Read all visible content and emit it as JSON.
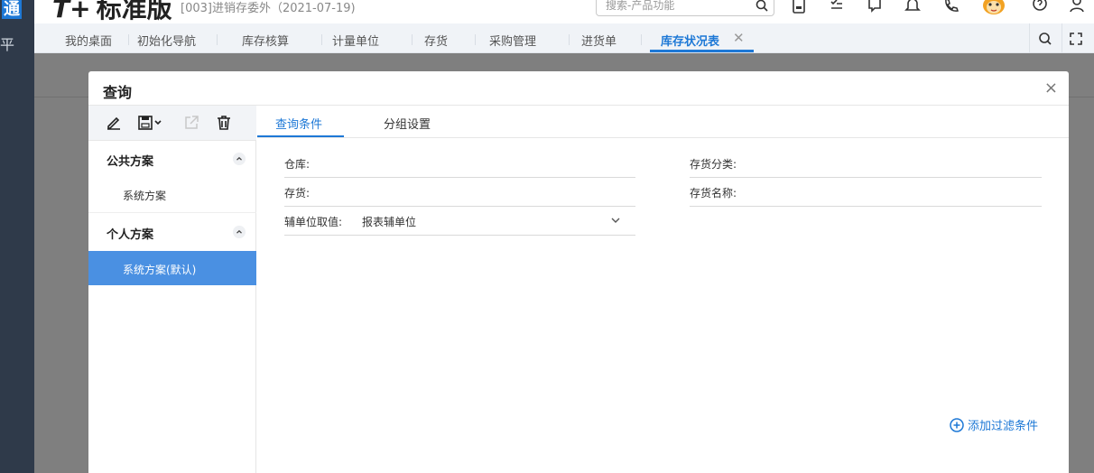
{
  "app": {
    "logo_text": "通",
    "brand_name": "标准版",
    "brand_prefix": "T+",
    "account": "[003]进销存委外（2021-07-19)",
    "search_placeholder": "搜索-产品功能"
  },
  "header_icons": [
    "calculator-icon",
    "checklist-icon",
    "chat-icon",
    "bell-icon",
    "phone-icon",
    "mascot-avatar-icon",
    "help-icon",
    "user-icon"
  ],
  "tabs": [
    {
      "label": "我的桌面"
    },
    {
      "label": "初始化导航"
    },
    {
      "label": "库存核算"
    },
    {
      "label": "计量单位"
    },
    {
      "label": "存货"
    },
    {
      "label": "采购管理"
    },
    {
      "label": "进货单"
    },
    {
      "label": "库存状况表",
      "active": true
    }
  ],
  "modal": {
    "title": "查询",
    "close": "×",
    "sidebar": {
      "groups": [
        {
          "label": "公共方案",
          "items": [
            "系统方案"
          ]
        },
        {
          "label": "个人方案",
          "items": [
            "系统方案(默认)"
          ]
        }
      ]
    },
    "content_tabs": [
      "查询条件",
      "分组设置"
    ],
    "fields": {
      "warehouse": {
        "label": "仓库:",
        "value": ""
      },
      "inventory_class": {
        "label": "存货分类:",
        "value": ""
      },
      "inventory": {
        "label": "存货:",
        "value": ""
      },
      "inventory_name": {
        "label": "存货名称:",
        "value": ""
      },
      "aux_unit": {
        "label": "辅单位取值:",
        "value": "报表辅单位"
      }
    },
    "add_filter": "添加过滤条件"
  },
  "colors": {
    "accent": "#1d78d6",
    "selected_row": "#4a90e2",
    "overlay": "#7f7f7f",
    "rail": "#2f3a4a"
  }
}
